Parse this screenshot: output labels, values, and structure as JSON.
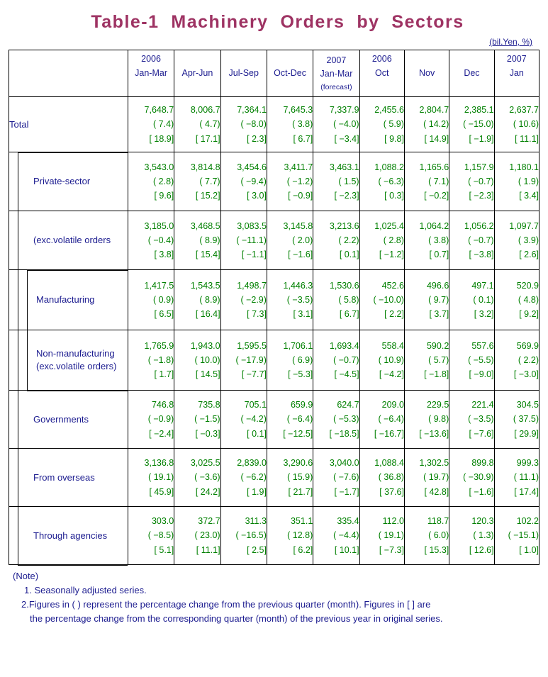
{
  "title": "Table-1  Machinery  Orders  by  Sectors",
  "unit_label": "(bil.Yen, %)",
  "header": {
    "row_label_blank": "",
    "columns": [
      {
        "year": "2006",
        "period": "Jan-Mar",
        "note": ""
      },
      {
        "year": "",
        "period": "Apr-Jun",
        "note": ""
      },
      {
        "year": "",
        "period": "Jul-Sep",
        "note": ""
      },
      {
        "year": "",
        "period": "Oct-Dec",
        "note": ""
      },
      {
        "year": "2007",
        "period": "Jan-Mar",
        "note": "(forecast)"
      },
      {
        "year": "2006",
        "period": "Oct",
        "note": ""
      },
      {
        "year": "",
        "period": "Nov",
        "note": ""
      },
      {
        "year": "",
        "period": "Dec",
        "note": ""
      },
      {
        "year": "2007",
        "period": "Jan",
        "note": ""
      }
    ]
  },
  "rows": [
    {
      "label": "Total",
      "label2": "",
      "indent": 0,
      "values": [
        "7,648.7",
        "8,006.7",
        "7,364.1",
        "7,645.3",
        "7,337.9",
        "2,455.6",
        "2,804.7",
        "2,385.1",
        "2,637.7"
      ],
      "paren": [
        "( 7.4)",
        "( 4.7)",
        "( −8.0)",
        "( 3.8)",
        "( −4.0)",
        "( 5.9)",
        "( 14.2)",
        "( −15.0)",
        "( 10.6)"
      ],
      "bracket": [
        "[ 18.9]",
        "[ 17.1]",
        "[ 2.3]",
        "[ 6.7]",
        "[ −3.4]",
        "[ 9.8]",
        "[ 14.9]",
        "[ −1.9]",
        "[ 11.1]"
      ]
    },
    {
      "label": "Private-sector",
      "label2": "",
      "indent": 1,
      "values": [
        "3,543.0",
        "3,814.8",
        "3,454.6",
        "3,411.7",
        "3,463.1",
        "1,088.2",
        "1,165.6",
        "1,157.9",
        "1,180.1"
      ],
      "paren": [
        "( 2.8)",
        "( 7.7)",
        "( −9.4)",
        "( −1.2)",
        "( 1.5)",
        "( −6.3)",
        "( 7.1)",
        "( −0.7)",
        "( 1.9)"
      ],
      "bracket": [
        "[ 9.6]",
        "[ 15.2]",
        "[ 3.0]",
        "[ −0.9]",
        "[ −2.3]",
        "[ 0.3]",
        "[ −0.2]",
        "[ −2.3]",
        "[ 3.4]"
      ]
    },
    {
      "label": "(exc.volatile orders",
      "label2": "",
      "indent": 1,
      "values": [
        "3,185.0",
        "3,468.5",
        "3,083.5",
        "3,145.8",
        "3,213.6",
        "1,025.4",
        "1,064.2",
        "1,056.2",
        "1,097.7"
      ],
      "paren": [
        "( −0.4)",
        "( 8.9)",
        "( −11.1)",
        "( 2.0)",
        "( 2.2)",
        "( 2.8)",
        "( 3.8)",
        "( −0.7)",
        "( 3.9)"
      ],
      "bracket": [
        "[ 3.8]",
        "[ 15.4]",
        "[ −1.1]",
        "[ −1.6]",
        "[ 0.1]",
        "[ −1.2]",
        "[ 0.7]",
        "[ −3.8]",
        "[ 2.6]"
      ]
    },
    {
      "label": "Manufacturing",
      "label2": "",
      "indent": 2,
      "values": [
        "1,417.5",
        "1,543.5",
        "1,498.7",
        "1,446.3",
        "1,530.6",
        "452.6",
        "496.6",
        "497.1",
        "520.9"
      ],
      "paren": [
        "( 0.9)",
        "( 8.9)",
        "( −2.9)",
        "( −3.5)",
        "( 5.8)",
        "( −10.0)",
        "( 9.7)",
        "( 0.1)",
        "( 4.8)"
      ],
      "bracket": [
        "[ 6.5]",
        "[ 16.4]",
        "[ 7.3]",
        "[ 3.1]",
        "[ 6.7]",
        "[ 2.2]",
        "[ 3.7]",
        "[ 3.2]",
        "[ 9.2]"
      ]
    },
    {
      "label": "Non-manufacturing",
      "label2": "(exc.volatile orders)",
      "indent": 2,
      "values": [
        "1,765.9",
        "1,943.0",
        "1,595.5",
        "1,706.1",
        "1,693.4",
        "558.4",
        "590.2",
        "557.6",
        "569.9"
      ],
      "paren": [
        "( −1.8)",
        "( 10.0)",
        "( −17.9)",
        "( 6.9)",
        "( −0.7)",
        "( 10.9)",
        "( 5.7)",
        "( −5.5)",
        "( 2.2)"
      ],
      "bracket": [
        "[ 1.7]",
        "[ 14.5]",
        "[ −7.7]",
        "[ −5.3]",
        "[ −4.5]",
        "[ −4.2]",
        "[ −1.8]",
        "[ −9.0]",
        "[ −3.0]"
      ]
    },
    {
      "label": "Governments",
      "label2": "",
      "indent": 1,
      "values": [
        "746.8",
        "735.8",
        "705.1",
        "659.9",
        "624.7",
        "209.0",
        "229.5",
        "221.4",
        "304.5"
      ],
      "paren": [
        "( −0.9)",
        "( −1.5)",
        "( −4.2)",
        "( −6.4)",
        "( −5.3)",
        "( −6.4)",
        "( 9.8)",
        "( −3.5)",
        "( 37.5)"
      ],
      "bracket": [
        "[ −2.4]",
        "[ −0.3]",
        "[ 0.1]",
        "[ −12.5]",
        "[ −18.5]",
        "[ −16.7]",
        "[ −13.6]",
        "[ −7.6]",
        "[ 29.9]"
      ]
    },
    {
      "label": "From overseas",
      "label2": "",
      "indent": 1,
      "values": [
        "3,136.8",
        "3,025.5",
        "2,839.0",
        "3,290.6",
        "3,040.0",
        "1,088.4",
        "1,302.5",
        "899.8",
        "999.3"
      ],
      "paren": [
        "( 19.1)",
        "( −3.6)",
        "( −6.2)",
        "( 15.9)",
        "( −7.6)",
        "( 36.8)",
        "( 19.7)",
        "( −30.9)",
        "( 11.1)"
      ],
      "bracket": [
        "[ 45.9]",
        "[ 24.2]",
        "[ 1.9]",
        "[ 21.7]",
        "[ −1.7]",
        "[ 37.6]",
        "[ 42.8]",
        "[ −1.6]",
        "[ 17.4]"
      ]
    },
    {
      "label": "Through agencies",
      "label2": "",
      "indent": 1,
      "values": [
        "303.0",
        "372.7",
        "311.3",
        "351.1",
        "335.4",
        "112.0",
        "118.7",
        "120.3",
        "102.2"
      ],
      "paren": [
        "( −8.5)",
        "( 23.0)",
        "( −16.5)",
        "( 12.8)",
        "( −4.4)",
        "( 19.1)",
        "( 6.0)",
        "( 1.3)",
        "( −15.1)"
      ],
      "bracket": [
        "[ 5.1]",
        "[ 11.1]",
        "[ 2.5]",
        "[ 6.2]",
        "[ 10.1]",
        "[ −7.3]",
        "[ 15.3]",
        "[ 12.6]",
        "[ 1.0]"
      ]
    }
  ],
  "notes": {
    "head": "(Note)",
    "item1": "1. Seasonally adjusted series.",
    "item2_line1": "2.Figures in ( ) represent the percentage change from the previous quarter (month). Figures in [ ] are",
    "item2_line2": "the percentage change from the corresponding quarter (month) of the previous year in original series."
  },
  "colors": {
    "title": "#9e3363",
    "label_text": "#1b1b8f",
    "data_text": "#008000",
    "border": "#000000",
    "background": "#ffffff"
  }
}
